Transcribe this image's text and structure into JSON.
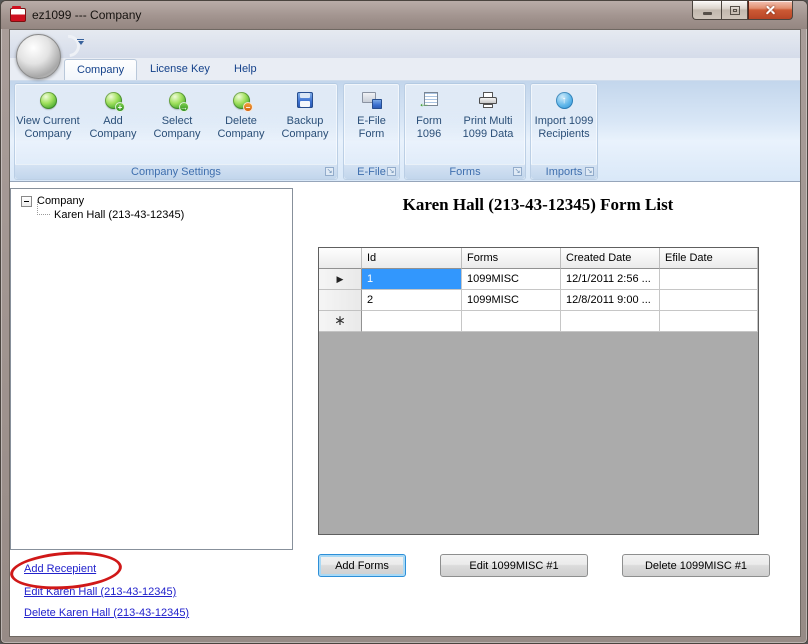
{
  "window": {
    "title": "ez1099 --- Company"
  },
  "ribbon": {
    "tabs": [
      {
        "label": "Company",
        "active": true
      },
      {
        "label": "License Key",
        "active": false
      },
      {
        "label": "Help",
        "active": false
      }
    ],
    "groups": [
      {
        "label": "Company Settings",
        "buttons": [
          {
            "label": "View Current Company",
            "icon": "globe-icon"
          },
          {
            "label": "Add Company",
            "icon": "globe-plus-icon"
          },
          {
            "label": "Select Company",
            "icon": "globe-arrow-icon"
          },
          {
            "label": "Delete Company",
            "icon": "globe-minus-icon"
          },
          {
            "label": "Backup Company",
            "icon": "floppy-disk-icon"
          }
        ]
      },
      {
        "label": "E-File",
        "buttons": [
          {
            "label": "E-File Form",
            "icon": "efile-card-icon"
          }
        ]
      },
      {
        "label": "Forms",
        "buttons": [
          {
            "label": "Form 1096",
            "icon": "form-arrow-icon"
          },
          {
            "label": "Print Multi 1099 Data",
            "icon": "printer-icon"
          }
        ]
      },
      {
        "label": "Imports",
        "buttons": [
          {
            "label": "Import 1099 Recipients",
            "icon": "import-up-arrow-icon"
          }
        ]
      }
    ]
  },
  "tree": {
    "root_label": "Company",
    "child_label": "Karen Hall (213-43-12345)"
  },
  "form_list": {
    "title": "Karen Hall (213-43-12345) Form List",
    "columns": [
      "Id",
      "Forms",
      "Created Date",
      "Efile Date"
    ],
    "rows": [
      {
        "id": "1",
        "forms": "1099MISC",
        "created_date": "12/1/2011 2:56 ...",
        "efile_date": "",
        "selected": true
      },
      {
        "id": "2",
        "forms": "1099MISC",
        "created_date": "12/8/2011 9:00 ...",
        "efile_date": "",
        "selected": false
      }
    ],
    "selected_row_glyph": "▶",
    "new_row_glyph": "∗"
  },
  "action_buttons": {
    "add_forms": "Add Forms",
    "edit_form": "Edit 1099MISC #1",
    "delete_form": "Delete 1099MISC #1"
  },
  "links": {
    "add_recipient": "Add Recepient",
    "edit_company": "Edit Karen Hall (213-43-12345)",
    "delete_company": "Delete Karen Hall (213-43-12345)"
  },
  "glyphs": {
    "plus": "+",
    "minus": "−",
    "select_arrow": "→",
    "import_arrow": "↑",
    "form_arrow": "←",
    "launcher": "↘"
  },
  "colors": {
    "selection_blue": "#3297fd",
    "ribbon_label_blue": "#2b4f78",
    "group_footer_blue": "#3f6fae",
    "link_blue": "#2222cc",
    "annotation_red": "#d01818",
    "titlebar_brown": "#a2948f",
    "grid_filler_gray": "#ababab"
  }
}
